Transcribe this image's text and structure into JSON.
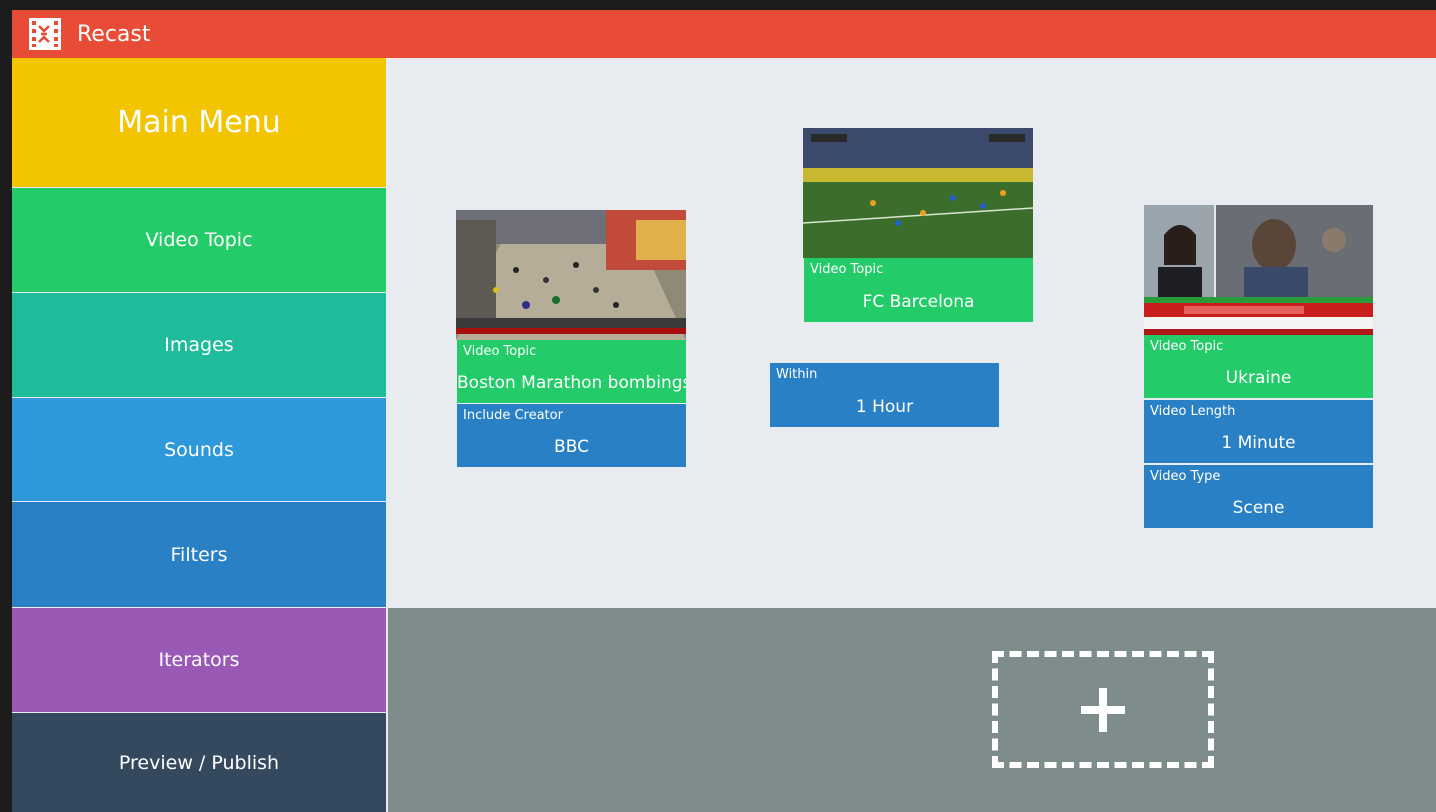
{
  "app": {
    "title": "Recast",
    "logo_icon": "film-strip-icon",
    "accent": "#e84c36"
  },
  "sidebar": {
    "items": [
      {
        "label": "Main Menu",
        "color": "#f2c500"
      },
      {
        "label": "Video Topic",
        "color": "#23cc68"
      },
      {
        "label": "Images",
        "color": "#1fbc9c"
      },
      {
        "label": "Sounds",
        "color": "#2d98da"
      },
      {
        "label": "Filters",
        "color": "#2a80c5"
      },
      {
        "label": "Iterators",
        "color": "#9b59b6"
      },
      {
        "label": "Preview / Publish",
        "color": "#34495e"
      }
    ]
  },
  "canvas": {
    "clips": [
      {
        "thumbnail": "marathon-crowd-image",
        "tiles": [
          {
            "label": "Video Topic",
            "value": "Boston Marathon bombings",
            "kind": "topic"
          },
          {
            "label": "Include Creator",
            "value": "BBC",
            "kind": "filter"
          }
        ]
      },
      {
        "thumbnail": "football-match-image",
        "tiles": [
          {
            "label": "Video Topic",
            "value": "FC Barcelona",
            "kind": "topic"
          }
        ]
      },
      {
        "thumbnail": null,
        "tiles": [
          {
            "label": "Within",
            "value": "1 Hour",
            "kind": "filter"
          }
        ]
      },
      {
        "thumbnail": "news-broadcast-image",
        "tiles": [
          {
            "label": "Video Topic",
            "value": "Ukraine",
            "kind": "topic"
          },
          {
            "label": "Video Length",
            "value": "1 Minute",
            "kind": "filter"
          },
          {
            "label": "Video Type",
            "value": "Scene",
            "kind": "filter"
          }
        ]
      }
    ]
  },
  "dropzone": {
    "icon": "plus-icon"
  }
}
